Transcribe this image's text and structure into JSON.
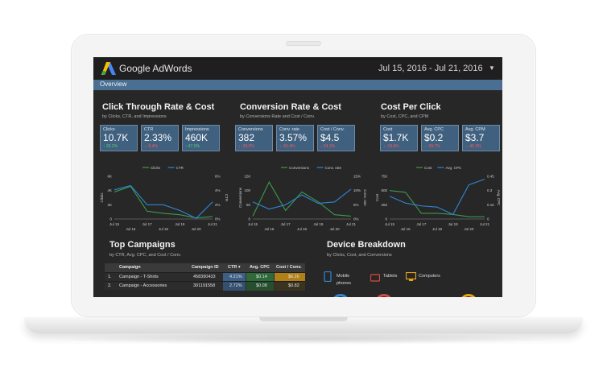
{
  "app": {
    "brand": "Google AdWords",
    "date_range": "Jul 15, 2016 - Jul 21, 2016",
    "tab": "Overview"
  },
  "sections": [
    {
      "title": "Click Through Rate & Cost",
      "subtitle": "by Clicks, CTR, and Impressions",
      "cards": [
        {
          "label": "Clicks",
          "value": "10.7K",
          "delta": "↑ 33.2%",
          "dir": "up"
        },
        {
          "label": "CTR",
          "value": "2.33%",
          "delta": "↓ -9.4%",
          "dir": "down"
        },
        {
          "label": "Impressions",
          "value": "460K",
          "delta": "↑ 47.0%",
          "dir": "up"
        }
      ]
    },
    {
      "title": "Conversion Rate & Cost",
      "subtitle": "by Conversions Rate and Cost / Conv.",
      "cards": [
        {
          "label": "Conversions",
          "value": "382",
          "delta": "↓ -39.2%",
          "dir": "down"
        },
        {
          "label": "Conv. rate",
          "value": "3.57%",
          "delta": "↓ -51.4%",
          "dir": "down"
        },
        {
          "label": "Cost / Conv.",
          "value": "$4.5",
          "delta": "↓ 24.1%",
          "dir": "down"
        }
      ]
    },
    {
      "title": "Cost Per Click",
      "subtitle": "by Cost, CPC, and CPM",
      "cards": [
        {
          "label": "Cost",
          "value": "$1.7K",
          "delta": "↓ -19.6%",
          "dir": "down"
        },
        {
          "label": "Avg. CPC",
          "value": "$0.2",
          "delta": "↓ -39.7%",
          "dir": "down"
        },
        {
          "label": "Avg. CPM",
          "value": "$3.7",
          "delta": "↓ -45.3%",
          "dir": "down"
        }
      ]
    }
  ],
  "colors": {
    "series_a": "#3c9a4e",
    "series_b": "#2f86d6",
    "axis": "#cfcfcf",
    "card_bg": "#40607f",
    "tab_bar": "#4a6f92"
  },
  "charts": [
    {
      "legend": [
        "Clicks",
        "CTR"
      ],
      "ylabel_left": "Clicks",
      "ylabel_right": "CTR",
      "left_ticks": [
        "6K",
        "4K",
        "2K",
        "0"
      ],
      "right_ticks": [
        "6%",
        "4%",
        "2%",
        "0%"
      ],
      "left_range": [
        0,
        6000
      ],
      "right_range": [
        0,
        6
      ],
      "a": [
        3800,
        4600,
        1100,
        800,
        600,
        150,
        350
      ],
      "b": [
        4100,
        4700,
        2000,
        2000,
        1200,
        100,
        2400
      ]
    },
    {
      "legend": [
        "Conversions",
        "Conv. rate"
      ],
      "ylabel_left": "Conversions",
      "ylabel_right": "Conv. rate",
      "left_ticks": [
        "150",
        "100",
        "50",
        "0"
      ],
      "right_ticks": [
        "15%",
        "10%",
        "5%",
        "0%"
      ],
      "left_range": [
        0,
        150
      ],
      "right_range": [
        0,
        15
      ],
      "a": [
        10,
        130,
        30,
        95,
        60,
        15,
        10
      ],
      "b": [
        60,
        35,
        50,
        85,
        55,
        60,
        105
      ]
    },
    {
      "legend": [
        "Cost",
        "Avg. CPC"
      ],
      "ylabel_left": "Cost",
      "ylabel_right": "Avg. CPC",
      "left_ticks": [
        "750",
        "500",
        "250",
        "0"
      ],
      "right_ticks": [
        "0.45",
        "0.3",
        "0.15",
        "0"
      ],
      "left_range": [
        0,
        750
      ],
      "right_range": [
        0,
        0.45
      ],
      "a": [
        500,
        470,
        100,
        100,
        80,
        40,
        40
      ],
      "b": [
        400,
        280,
        230,
        210,
        80,
        600,
        700
      ]
    }
  ],
  "x_ticks_row1": [
    "Jul 15",
    "Jul 17",
    "Jul 19",
    "Jul 21"
  ],
  "x_ticks_row2": [
    "Jul 16",
    "Jul 18",
    "Jul 20"
  ],
  "campaigns": {
    "title": "Top Campaigns",
    "subtitle": "by CTR, Avg. CPC, and Cost / Conv.",
    "columns": [
      "Campaign",
      "Campaign ID",
      "CTR ▾",
      "Avg. CPC",
      "Cost / Conv."
    ],
    "rows": [
      [
        "1.",
        "Campaign - T-Shirts",
        "458390433",
        "4.21%",
        "$0.14",
        "$6.26"
      ],
      [
        "2.",
        "Campaign - Accessories",
        "301191558",
        "2.72%",
        "$0.08",
        "$0.82"
      ]
    ]
  },
  "devices": {
    "title": "Device Breakdown",
    "subtitle": "by Clicks, Cost, and Conversions",
    "items": [
      {
        "label": "Mobile phones",
        "icon": "mobile-icon",
        "color": "#2f86d6"
      },
      {
        "label": "Tablets",
        "icon": "tablet-icon",
        "color": "#d84b3c"
      },
      {
        "label": "Computers",
        "icon": "computer-icon",
        "color": "#e8a317"
      }
    ]
  }
}
